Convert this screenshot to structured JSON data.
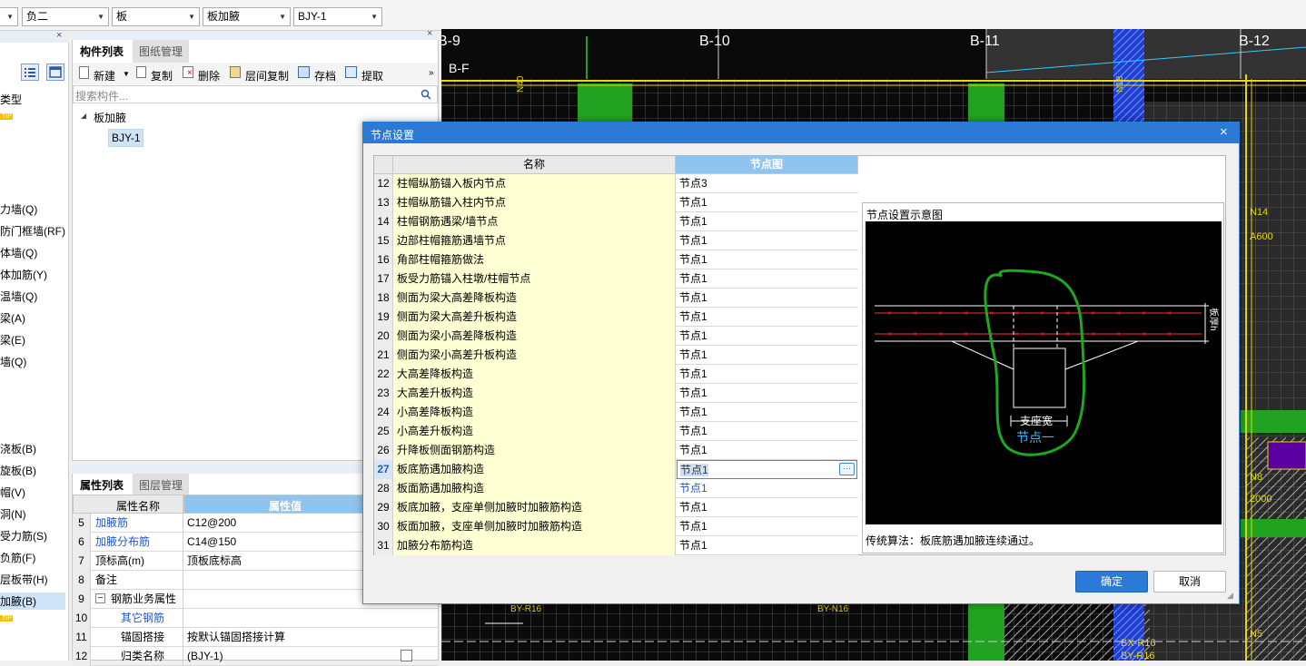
{
  "toolbar": {
    "dd1": "",
    "dd2": "负二",
    "dd3": "板",
    "dd4": "板加腋",
    "dd5": "BJY-1"
  },
  "left_nav": {
    "items": [
      "类型",
      "力墙(Q)",
      "防门框墙(RF)",
      "体墙(Q)",
      "体加筋(Y)",
      "温墙(Q)",
      "梁(A)",
      "梁(E)",
      "墙(Q)",
      "浇板(B)",
      "旋板(B)",
      "帽(V)",
      "洞(N)",
      "受力筋(S)",
      "负筋(F)",
      "层板带(H)",
      "加腋(B)"
    ],
    "badge": "TIP"
  },
  "component_panel": {
    "tabs": [
      "构件列表",
      "图纸管理"
    ],
    "buttons": [
      "新建",
      "复制",
      "删除",
      "层间复制",
      "存档",
      "提取"
    ],
    "search_placeholder": "搜索构件...",
    "tree_root": "板加腋",
    "tree_child": "BJY-1"
  },
  "property_panel": {
    "tabs": [
      "属性列表",
      "图层管理"
    ],
    "headers": [
      "属性名称",
      "属性值"
    ],
    "rows": [
      {
        "num": "5",
        "name": "加腋筋",
        "value": "C12@200",
        "blue": true
      },
      {
        "num": "6",
        "name": "加腋分布筋",
        "value": "C14@150",
        "blue": true
      },
      {
        "num": "7",
        "name": "顶标高(m)",
        "value": "顶板底标高",
        "blue": false
      },
      {
        "num": "8",
        "name": "备注",
        "value": "",
        "blue": false
      },
      {
        "num": "9",
        "name": "钢筋业务属性",
        "value": "",
        "blue": false
      },
      {
        "num": "10",
        "name": "其它钢筋",
        "value": "",
        "blue": true
      },
      {
        "num": "11",
        "name": "锚固搭接",
        "value": "按默认锚固搭接计算",
        "blue": false
      },
      {
        "num": "12",
        "name": "归类名称",
        "value": "(BJY-1)",
        "blue": false
      }
    ],
    "collapse_sign": "−"
  },
  "cad": {
    "grid_labels": [
      "B-9",
      "B-10",
      "B-11",
      "B-12",
      "B-F"
    ],
    "texts": [
      "N40",
      "N18",
      "N14",
      "A600",
      "N8",
      "2000",
      "N5",
      "BX-R16",
      "BY-R16",
      "BY-R16",
      "BY-N16"
    ]
  },
  "dialog": {
    "title": "节点设置",
    "close": "×",
    "col_name": "名称",
    "col_node": "节点图",
    "rows": [
      {
        "num": "12",
        "name": "柱帽纵筋锚入板内节点",
        "node": "节点3"
      },
      {
        "num": "13",
        "name": "柱帽纵筋锚入柱内节点",
        "node": "节点1"
      },
      {
        "num": "14",
        "name": "柱帽钢筋遇梁/墙节点",
        "node": "节点1"
      },
      {
        "num": "15",
        "name": "边部柱帽箍筋遇墙节点",
        "node": "节点1"
      },
      {
        "num": "16",
        "name": "角部柱帽箍筋做法",
        "node": "节点1"
      },
      {
        "num": "17",
        "name": "板受力筋锚入柱墩/柱帽节点",
        "node": "节点1"
      },
      {
        "num": "18",
        "name": "侧面为梁大高差降板构造",
        "node": "节点1"
      },
      {
        "num": "19",
        "name": "侧面为梁大高差升板构造",
        "node": "节点1"
      },
      {
        "num": "20",
        "name": "侧面为梁小高差降板构造",
        "node": "节点1"
      },
      {
        "num": "21",
        "name": "侧面为梁小高差升板构造",
        "node": "节点1"
      },
      {
        "num": "22",
        "name": "大高差降板构造",
        "node": "节点1"
      },
      {
        "num": "23",
        "name": "大高差升板构造",
        "node": "节点1"
      },
      {
        "num": "24",
        "name": "小高差降板构造",
        "node": "节点1"
      },
      {
        "num": "25",
        "name": "小高差升板构造",
        "node": "节点1"
      },
      {
        "num": "26",
        "name": "升降板侧面钢筋构造",
        "node": "节点1"
      },
      {
        "num": "27",
        "name": "板底筋遇加腋构造",
        "node": "节点1",
        "selected": true
      },
      {
        "num": "28",
        "name": "板面筋遇加腋构造",
        "node": "节点1",
        "blue": true
      },
      {
        "num": "29",
        "name": "板底加腋，支座单侧加腋时加腋筋构造",
        "node": "节点1"
      },
      {
        "num": "30",
        "name": "板面加腋，支座单侧加腋时加腋筋构造",
        "node": "节点1"
      },
      {
        "num": "31",
        "name": "加腋分布筋构造",
        "node": "节点1"
      }
    ],
    "ellipsis": "···",
    "preview_title": "节点设置示意图",
    "diagram_label_width": "支座宽",
    "diagram_label_node": "节点一",
    "diagram_label_h": "板厚h",
    "description": "传统算法：板底筋遇加腋连续通过。",
    "ok": "确定",
    "cancel": "取消"
  }
}
